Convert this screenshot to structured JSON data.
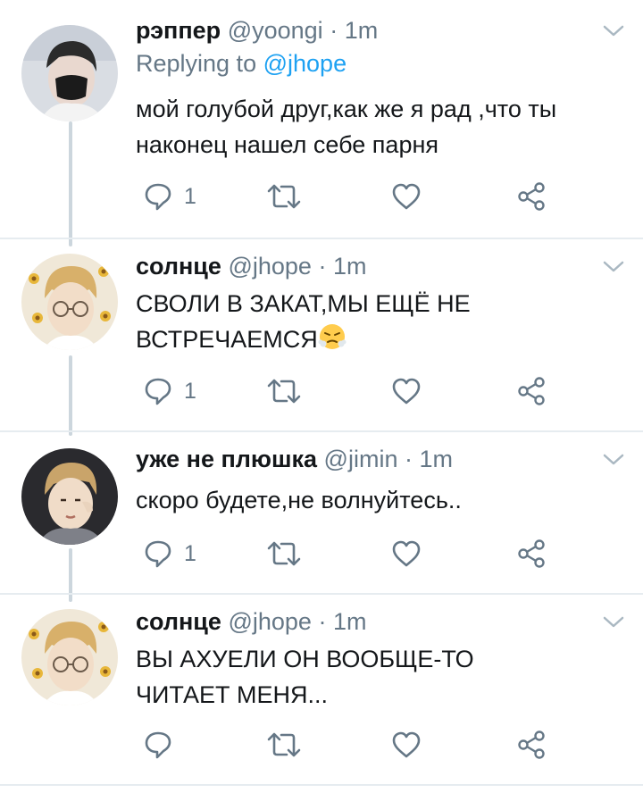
{
  "colors": {
    "accent": "#1da1f2",
    "secondary_text": "#657786",
    "primary_text": "#14171a",
    "thread_line": "#ccd6dd"
  },
  "tweets": [
    {
      "name": "рэппер",
      "handle": "@yoongi",
      "dot": "·",
      "time": "1m",
      "replying_label": "Replying to",
      "replying_mention": "@jhope",
      "lines": [
        "мой голубой друг,как же я рад ,что  ты",
        "наконец нашел себе парня"
      ],
      "reply_count": "1"
    },
    {
      "name": "солнце",
      "handle": "@jhope",
      "dot": "·",
      "time": "1m",
      "lines": [
        "СВОЛИ В ЗАКАТ,МЫ ЕЩЁ НЕ",
        "ВСТРЕЧАЕМСЯ"
      ],
      "emoji": "huffing-face",
      "reply_count": "1"
    },
    {
      "name": "уже не плюшка",
      "handle": "@jimin",
      "dot": "·",
      "time": "1m",
      "lines": [
        "скоро будете,не волнуйтесь.."
      ],
      "reply_count": "1"
    },
    {
      "name": "солнце",
      "handle": "@jhope",
      "dot": "·",
      "time": "1m",
      "lines": [
        "ВЫ АХУЕЛИ ОН ВООБЩЕ-ТО",
        "ЧИТАЕТ МЕНЯ..."
      ],
      "reply_count": ""
    }
  ],
  "icons": [
    "reply-icon",
    "retweet-icon",
    "like-icon",
    "share-icon",
    "chevron-down-icon"
  ]
}
